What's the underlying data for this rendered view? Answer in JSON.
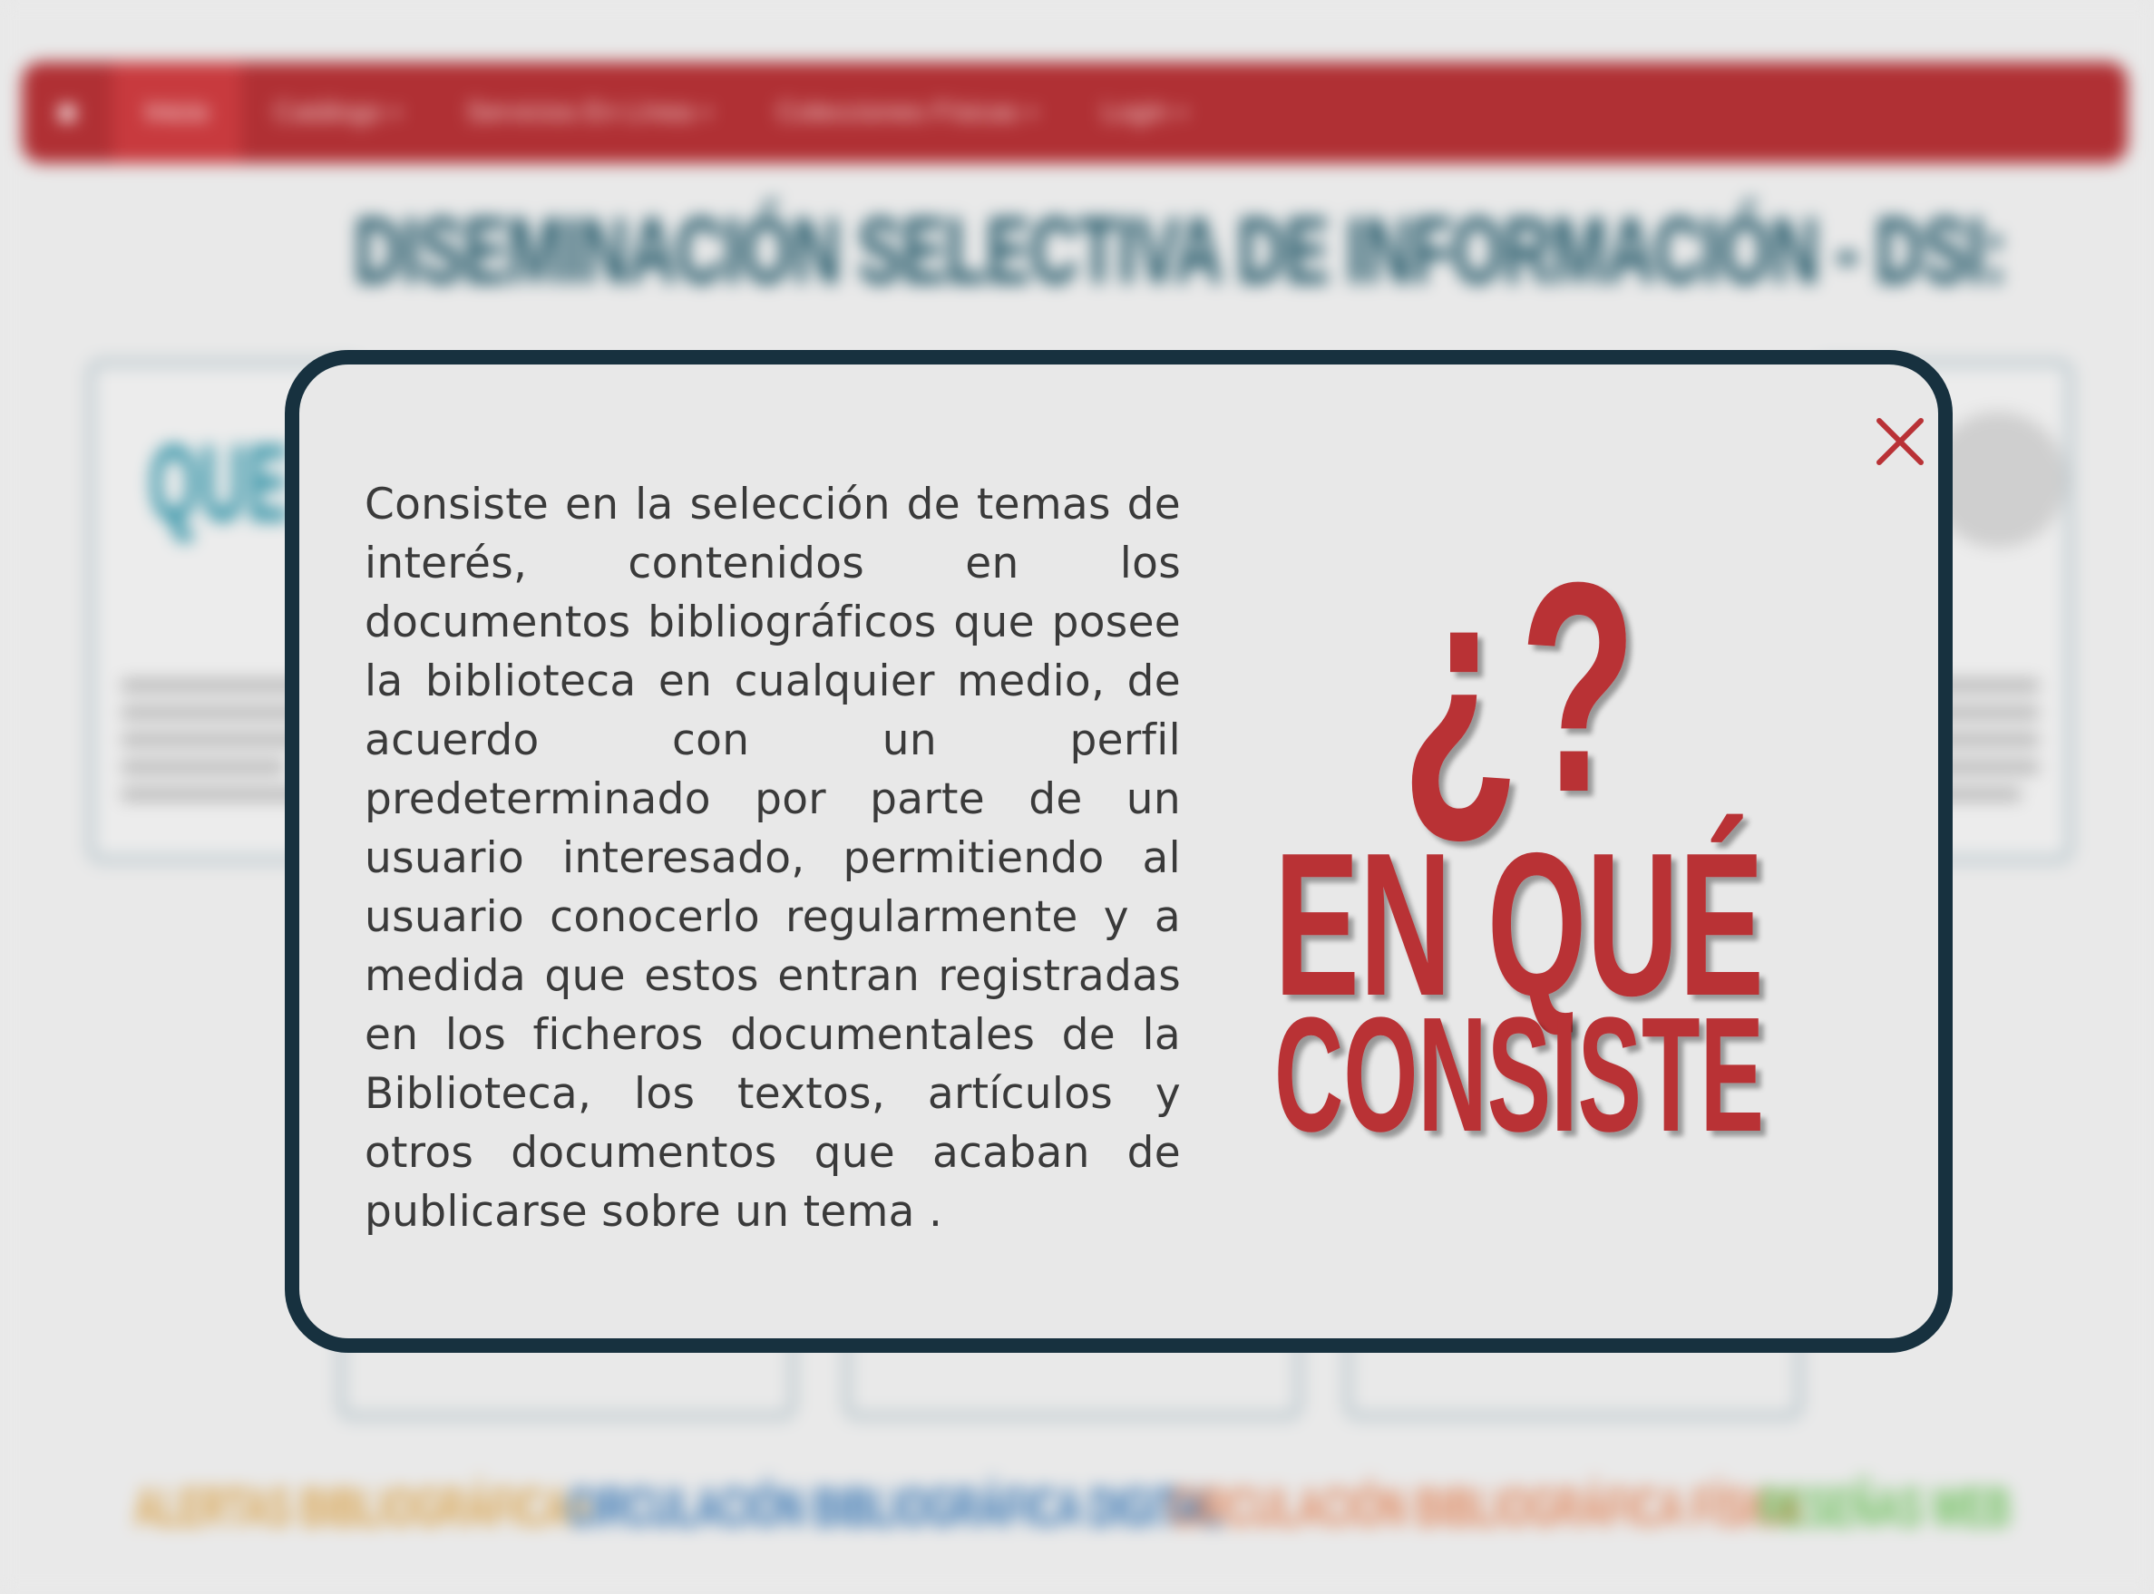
{
  "navbar": {
    "home_icon": "home-icon",
    "items": [
      {
        "label": "Inicio",
        "active": true,
        "dropdown": false
      },
      {
        "label": "Catálogo",
        "active": false,
        "dropdown": true
      },
      {
        "label": "Servicios En Línea",
        "active": false,
        "dropdown": true
      },
      {
        "label": "Colecciones Físicas",
        "active": false,
        "dropdown": true
      },
      {
        "label": "Login",
        "active": false,
        "dropdown": true
      }
    ],
    "color": "#b03034"
  },
  "page": {
    "title": "DISEMINACIÓN SELECTIVA DE INFORMACIÓN - DSI:",
    "card_left_heading": "QUE",
    "bottom_links": [
      {
        "label": "ALERTAS BIBLIOGRÁFICAS",
        "color": "#d9a24a"
      },
      {
        "label": "CIRCULACIÓN BIBLIOGRÁFICA DIGITAL",
        "color": "#2d6fb0"
      },
      {
        "label": "CIRCULACIÓN BIBLIOGRÁFICA FÍSICA",
        "color": "#e0855a"
      },
      {
        "label": "RESEÑAS WEB",
        "color": "#6bbf59"
      }
    ]
  },
  "modal": {
    "close_icon": "close-icon",
    "body_text": "Consiste en la selección de temas de interés, contenidos en los documentos bibliográficos que posee la biblioteca en cualquier medio, de acuerdo con un perfil predeterminado por parte de un usuario interesado, permitiendo al usuario conocerlo regularmente y a medida que estos entran registradas en los ficheros documentales de la Biblioteca, los textos, artículos y otros documentos que acaban de publicarse sobre un tema .",
    "graphic": {
      "marks": "¿?",
      "line1": "EN QUÉ",
      "line2": "CONSISTE",
      "color": "#b93236"
    },
    "border_color": "#17313f"
  }
}
